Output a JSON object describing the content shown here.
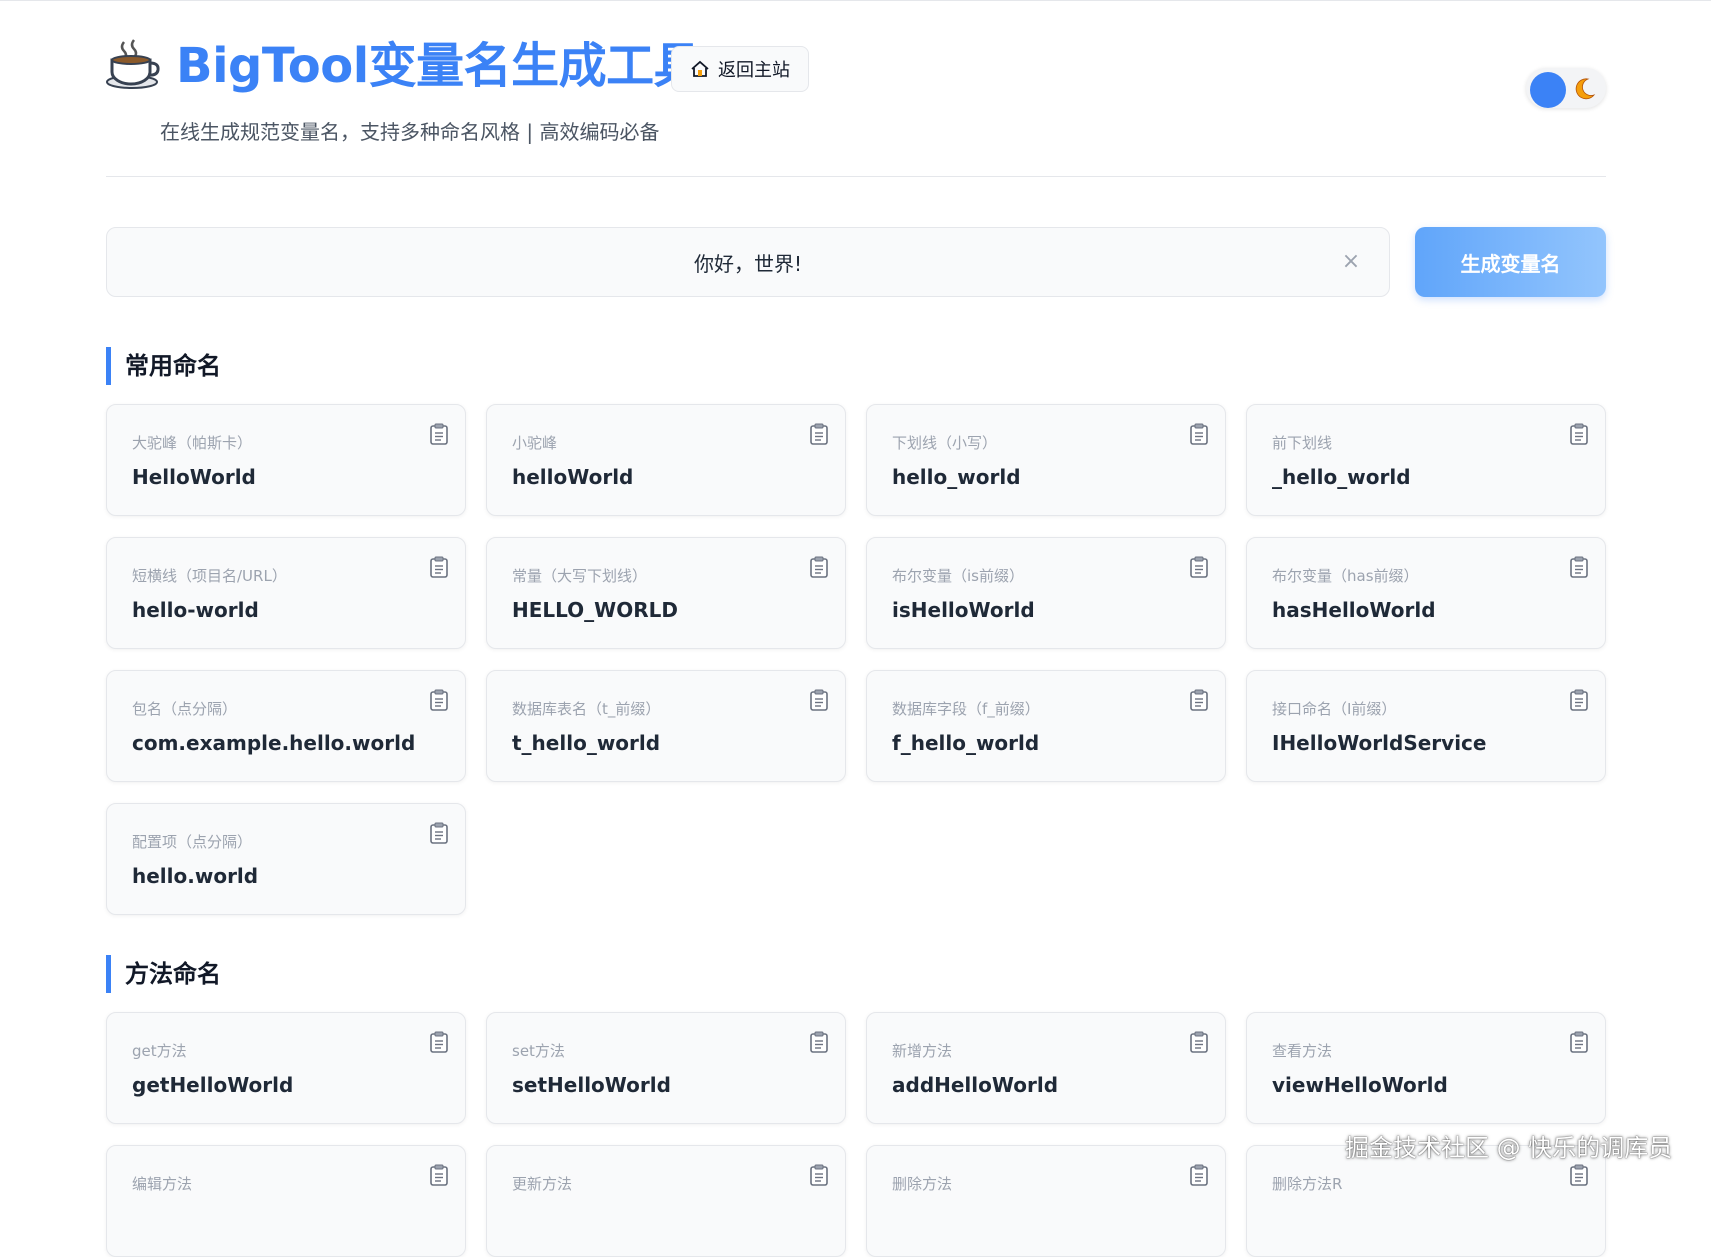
{
  "header": {
    "logo_icon": "coffee-cup-icon",
    "title": "BigTool变量名生成工具",
    "home_button": {
      "icon": "home-icon",
      "label": "返回主站"
    },
    "subtitle": "在线生成规范变量名，支持多种命名风格 | 高效编码必备",
    "theme_toggle": {
      "icon": "moon-icon",
      "knob_color": "#3b82f6"
    }
  },
  "search": {
    "value": "你好，世界!",
    "clear_icon": "close-icon",
    "generate_label": "生成变量名"
  },
  "sections": [
    {
      "title": "常用命名",
      "cards": [
        {
          "label": "大驼峰（帕斯卡）",
          "value": "HelloWorld"
        },
        {
          "label": "小驼峰",
          "value": "helloWorld"
        },
        {
          "label": "下划线（小写）",
          "value": "hello_world"
        },
        {
          "label": "前下划线",
          "value": "_hello_world"
        },
        {
          "label": "短横线（项目名/URL）",
          "value": "hello-world"
        },
        {
          "label": "常量（大写下划线）",
          "value": "HELLO_WORLD"
        },
        {
          "label": "布尔变量（is前缀）",
          "value": "isHelloWorld"
        },
        {
          "label": "布尔变量（has前缀）",
          "value": "hasHelloWorld"
        },
        {
          "label": "包名（点分隔）",
          "value": "com.example.hello.world"
        },
        {
          "label": "数据库表名（t_前缀）",
          "value": "t_hello_world"
        },
        {
          "label": "数据库字段（f_前缀）",
          "value": "f_hello_world"
        },
        {
          "label": "接口命名（I前缀）",
          "value": "IHelloWorldService"
        },
        {
          "label": "配置项（点分隔）",
          "value": "hello.world"
        }
      ]
    },
    {
      "title": "方法命名",
      "cards": [
        {
          "label": "get方法",
          "value": "getHelloWorld"
        },
        {
          "label": "set方法",
          "value": "setHelloWorld"
        },
        {
          "label": "新增方法",
          "value": "addHelloWorld"
        },
        {
          "label": "查看方法",
          "value": "viewHelloWorld"
        },
        {
          "label": "编辑方法",
          "value": ""
        },
        {
          "label": "更新方法",
          "value": ""
        },
        {
          "label": "删除方法",
          "value": ""
        },
        {
          "label": "删除方法R",
          "value": ""
        }
      ]
    }
  ],
  "card_copy_icon": "clipboard-icon",
  "accent_color": "#3b82f6",
  "watermark": "掘金技术社区 @ 快乐的调库员"
}
